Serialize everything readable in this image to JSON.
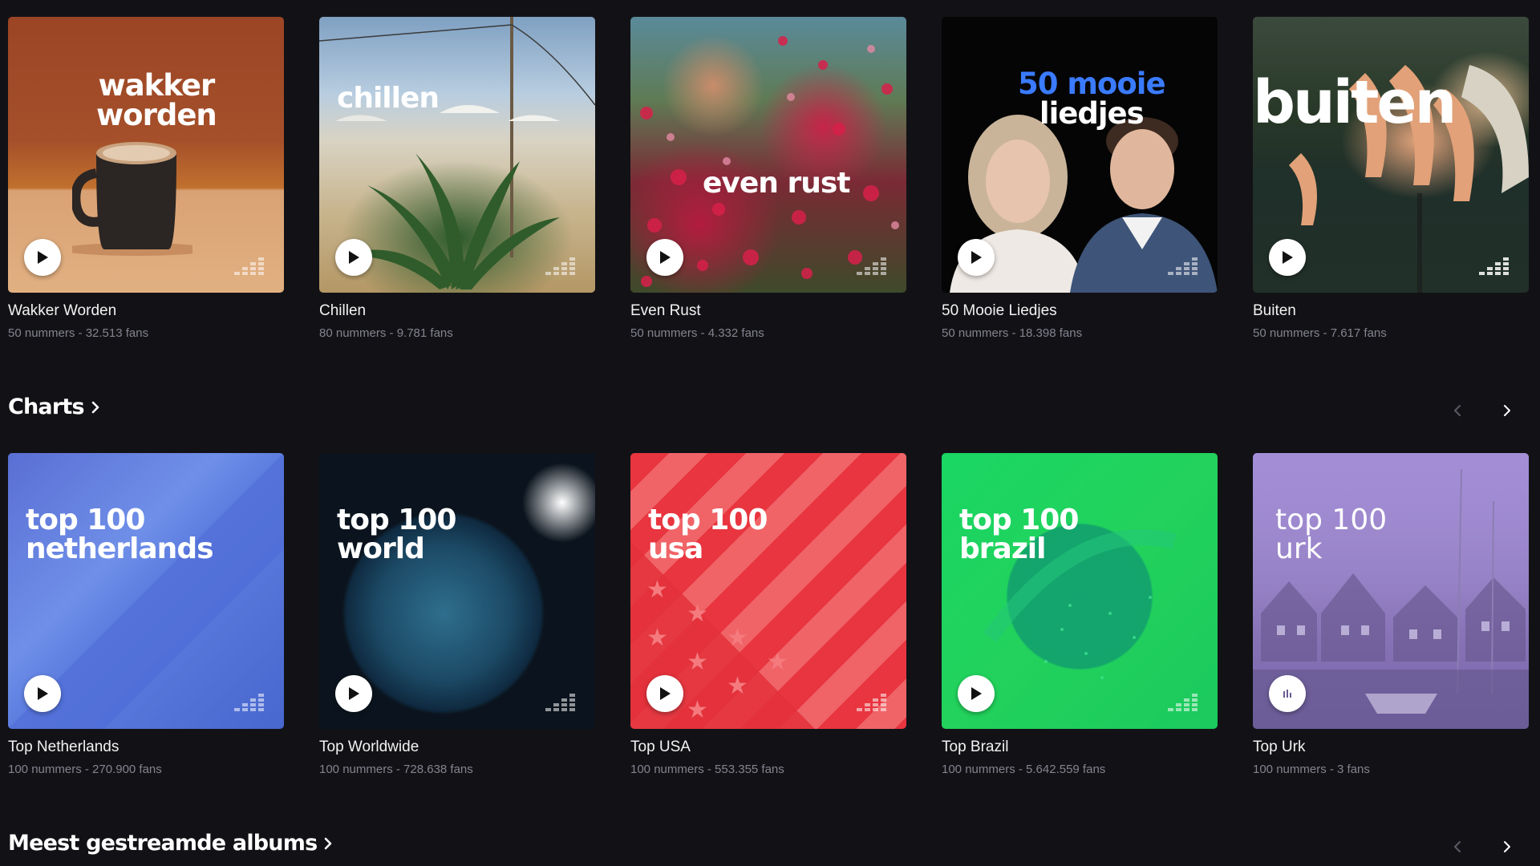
{
  "row1": [
    {
      "cover_line1": "wakker",
      "cover_line2": "worden",
      "title": "Wakker Worden",
      "sub": "50 nummers - 32.513 fans"
    },
    {
      "cover_line1": "chillen",
      "cover_line2": "",
      "title": "Chillen",
      "sub": "80 nummers - 9.781 fans"
    },
    {
      "cover_line1": "even rust",
      "cover_line2": "",
      "title": "Even Rust",
      "sub": "50 nummers - 4.332 fans"
    },
    {
      "cover_line1": "50 mooie",
      "cover_line2": "liedjes",
      "title": "50 Mooie Liedjes",
      "sub": "50 nummers - 18.398 fans"
    },
    {
      "cover_line1": "buiten",
      "cover_line2": "",
      "title": "Buiten",
      "sub": "50 nummers - 7.617 fans"
    }
  ],
  "charts": {
    "header": "Charts",
    "items": [
      {
        "cover_line1": "top 100",
        "cover_line2": "netherlands",
        "title": "Top Netherlands",
        "sub": "100 nummers - 270.900 fans"
      },
      {
        "cover_line1": "top 100",
        "cover_line2": "world",
        "title": "Top Worldwide",
        "sub": "100 nummers - 728.638 fans"
      },
      {
        "cover_line1": "top 100",
        "cover_line2": "usa",
        "title": "Top USA",
        "sub": "100 nummers - 553.355 fans"
      },
      {
        "cover_line1": "top 100",
        "cover_line2": "brazil",
        "title": "Top Brazil",
        "sub": "100 nummers - 5.642.559 fans"
      },
      {
        "cover_line1": "top 100",
        "cover_line2": "urk",
        "title": "Top Urk",
        "sub": "100 nummers - 3 fans"
      }
    ]
  },
  "albums": {
    "header": "Meest gestreamde albums"
  },
  "colors": {
    "background": "#121216",
    "subtext": "#83838f",
    "mooie_accent": "#3a7bff"
  },
  "icons": {
    "play": "play-icon",
    "playing": "equalizer-playing-icon",
    "deezer": "deezer-logo-icon",
    "prev": "chevron-left-icon",
    "next": "chevron-right-icon",
    "header_chevron": "chevron-right-icon"
  }
}
